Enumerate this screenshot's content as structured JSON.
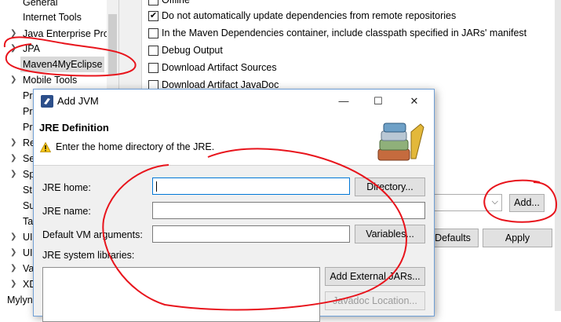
{
  "tree": {
    "items": [
      {
        "label": "General",
        "expandable": false
      },
      {
        "label": "Internet Tools",
        "expandable": false
      },
      {
        "label": "Java Enterprise Pro",
        "expandable": true
      },
      {
        "label": "JPA",
        "expandable": true
      },
      {
        "label": "Maven4MyEclipse",
        "expandable": false,
        "selected": true
      },
      {
        "label": "Mobile Tools",
        "expandable": true
      },
      {
        "label": "Pr",
        "expandable": false
      },
      {
        "label": "Pr",
        "expandable": false
      },
      {
        "label": "Pr",
        "expandable": false
      },
      {
        "label": "Re",
        "expandable": true
      },
      {
        "label": "Se",
        "expandable": true
      },
      {
        "label": "Sp",
        "expandable": true
      },
      {
        "label": "St",
        "expandable": false
      },
      {
        "label": "Su",
        "expandable": false
      },
      {
        "label": "Ta",
        "expandable": false
      },
      {
        "label": "UI",
        "expandable": true
      },
      {
        "label": "UI",
        "expandable": true
      },
      {
        "label": "Va",
        "expandable": true
      },
      {
        "label": "XD",
        "expandable": true
      }
    ],
    "footer_label": "Mylyn"
  },
  "options": [
    {
      "label": "Offline",
      "checked": false
    },
    {
      "label": "Do not automatically update dependencies from remote repositories",
      "checked": true
    },
    {
      "label": "In the Maven Dependencies container, include classpath specified in JARs' manifest",
      "checked": false
    },
    {
      "label": "Debug Output",
      "checked": false
    },
    {
      "label": "Download Artifact Sources",
      "checked": false
    },
    {
      "label": "Download Artifact JavaDoc",
      "checked": false
    }
  ],
  "pref_buttons": {
    "add": "Add...",
    "restore_defaults": "Defaults",
    "apply": "Apply"
  },
  "dialog": {
    "title": "Add JVM",
    "banner_title": "JRE Definition",
    "banner_message": "Enter the home directory of the JRE.",
    "fields": {
      "jre_home": {
        "label": "JRE home:",
        "value": ""
      },
      "jre_name": {
        "label": "JRE name:",
        "value": ""
      },
      "vm_args": {
        "label": "Default VM arguments:",
        "value": ""
      }
    },
    "libraries_label": "JRE system libraries:",
    "buttons": {
      "directory": "Directory...",
      "variables": "Variables...",
      "add_external_jars": "Add External JARs...",
      "javadoc_location": "Javadoc Location..."
    },
    "window_controls": {
      "minimize": "—",
      "maximize": "☐",
      "close": "✕"
    }
  },
  "colors": {
    "annotation": "#e8141c",
    "dialog_border": "#6f9fd6",
    "focus_border": "#0078d7"
  }
}
